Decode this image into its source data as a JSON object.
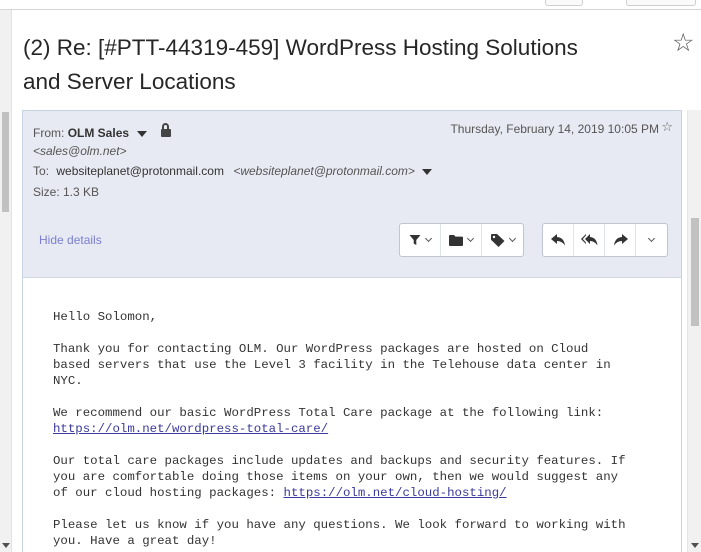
{
  "subject": {
    "line1": "(2) Re: [#PTT-44319-459] WordPress Hosting Solutions",
    "line2": "and Server Locations",
    "star_glyph": "☆"
  },
  "message": {
    "from_label": "From:",
    "sender_name": "OLM Sales",
    "sender_email": "<sales@olm.net>",
    "to_label": "To:",
    "recipient": "websiteplanet@protonmail.com",
    "recipient_full": "<websiteplanet@protonmail.com>",
    "size_label": "Size: 1.3 KB",
    "date": "Thursday, February 14, 2019 10:05 PM",
    "star_glyph": "☆",
    "hide_details": "Hide details"
  },
  "toolbar": {
    "icons": [
      "filter-icon",
      "folder-icon",
      "label-icon",
      "reply-icon",
      "reply-all-icon",
      "forward-icon",
      "more-icon"
    ]
  },
  "body": {
    "greeting": "Hello Solomon,",
    "p1": "Thank you for contacting OLM. Our WordPress packages are hosted on Cloud\nbased servers that use the Level 3 facility in the Telehouse data center in\nNYC.",
    "p2_text": "We recommend our basic WordPress Total Care package at the following link:",
    "p2_link": "https://olm.net/wordpress-total-care/",
    "p3_text": "Our total care packages include updates and backups and security features. If\nyou are comfortable doing those items on your own, then we would suggest any\nof our cloud hosting packages: ",
    "p3_link": "https://olm.net/cloud-hosting/",
    "p4": "Please let us know if you have any questions. We look forward to working with\nyou. Have a great day!"
  },
  "colors": {
    "header_bg": "#e7eaf2",
    "link": "#3a3a9a",
    "hide_details": "#7b7fd0"
  }
}
